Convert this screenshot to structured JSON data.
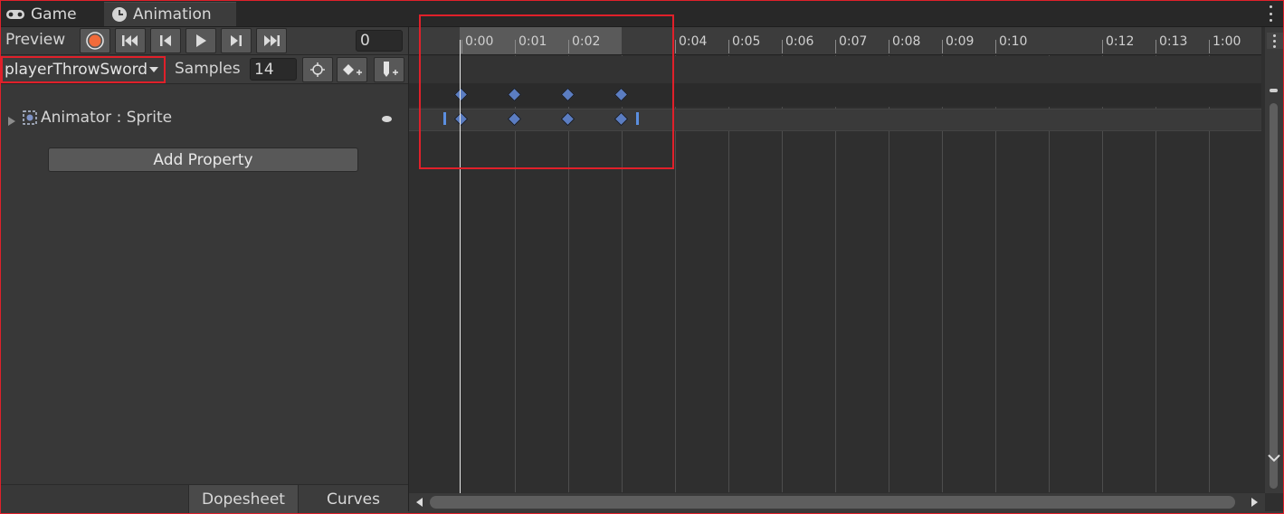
{
  "tabs": [
    {
      "label": "Game",
      "icon": "gamepad-icon"
    },
    {
      "label": "Animation",
      "icon": "clock-icon"
    }
  ],
  "toolbar": {
    "preview_label": "Preview",
    "frame_value": "0",
    "samples_label": "Samples",
    "samples_value": "14"
  },
  "clip": {
    "name": "playerThrowSword"
  },
  "property": {
    "label": "Animator : Sprite"
  },
  "add_property_label": "Add Property",
  "bottom_tabs": {
    "dopesheet": "Dopesheet",
    "curves": "Curves"
  },
  "timeline": {
    "ticks": [
      "0:00",
      "0:01",
      "0:02",
      "0:04",
      "0:05",
      "0:06",
      "0:07",
      "0:08",
      "0:09",
      "0:10",
      "0:12",
      "0:13",
      "1:00"
    ]
  },
  "colors": {
    "accent_red": "#e0202a",
    "record_orange": "#f26b3a",
    "keyframe_blue": "#5b7dc2"
  }
}
